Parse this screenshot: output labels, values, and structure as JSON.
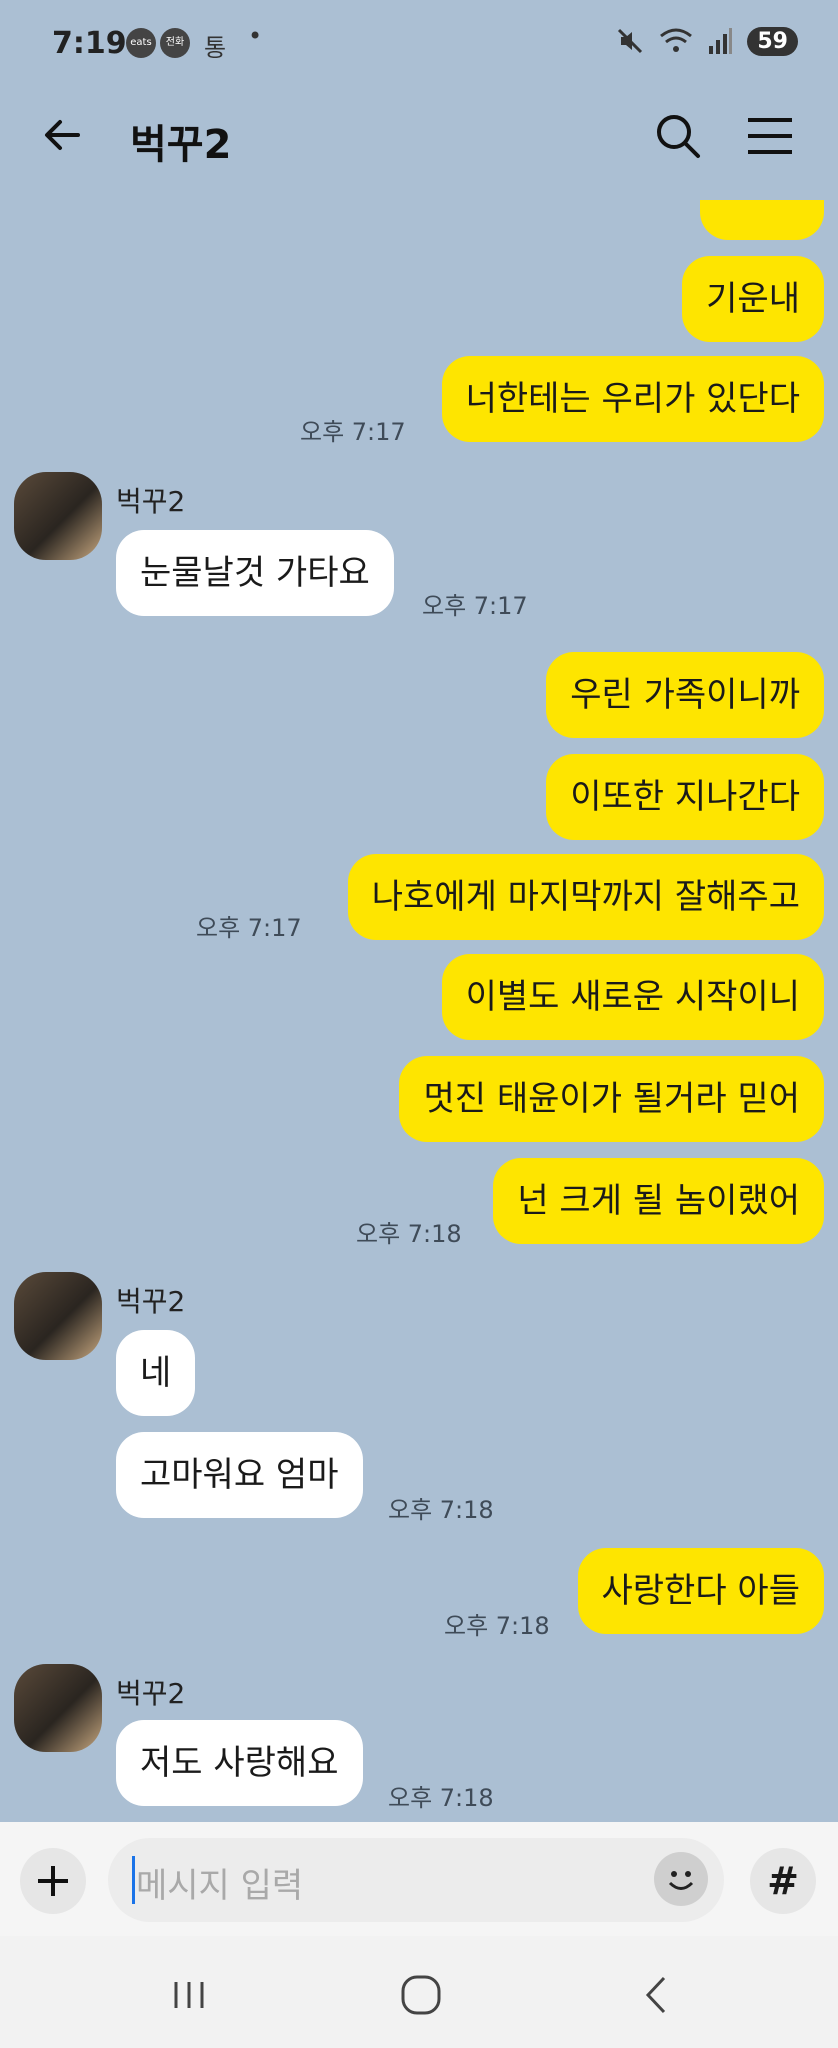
{
  "status_bar": {
    "time": "7:19",
    "icons": [
      "eats",
      "전화",
      "통"
    ],
    "battery": "59"
  },
  "header": {
    "title": "벅꾸2"
  },
  "messages": [
    {
      "text": "기운내",
      "time": ""
    },
    {
      "text": "너한테는 우리가 있단다",
      "time": "오후 7:17"
    },
    {
      "sender": "벅꾸2",
      "text": "눈물날것 가타요",
      "time": "오후 7:17"
    },
    {
      "text": "우린 가족이니까",
      "time": ""
    },
    {
      "text": "이또한 지나간다",
      "time": ""
    },
    {
      "text": "나호에게 마지막까지 잘해주고",
      "time": "오후 7:17"
    },
    {
      "text": "이별도 새로운 시작이니",
      "time": ""
    },
    {
      "text": "멋진 태윤이가 될거라 믿어",
      "time": ""
    },
    {
      "text": "넌 크게 될 놈이랬어",
      "time": "오후 7:18"
    },
    {
      "sender": "벅꾸2",
      "text": "네",
      "time": ""
    },
    {
      "text": "고마워요 엄마",
      "time": "오후 7:18"
    },
    {
      "text": "사랑한다 아들",
      "time": "오후 7:18"
    },
    {
      "sender": "벅꾸2",
      "text": "저도 사랑해요",
      "time": "오후 7:18"
    }
  ],
  "input": {
    "placeholder": "메시지 입력"
  },
  "colors": {
    "background": "#abbfd3",
    "my_bubble": "#fee500",
    "their_bubble": "#ffffff"
  },
  "icons": [
    "back-arrow-icon",
    "search-icon",
    "menu-icon",
    "plus-icon",
    "emoji-icon",
    "hash-icon",
    "recent-apps-icon",
    "home-icon",
    "nav-back-icon"
  ]
}
